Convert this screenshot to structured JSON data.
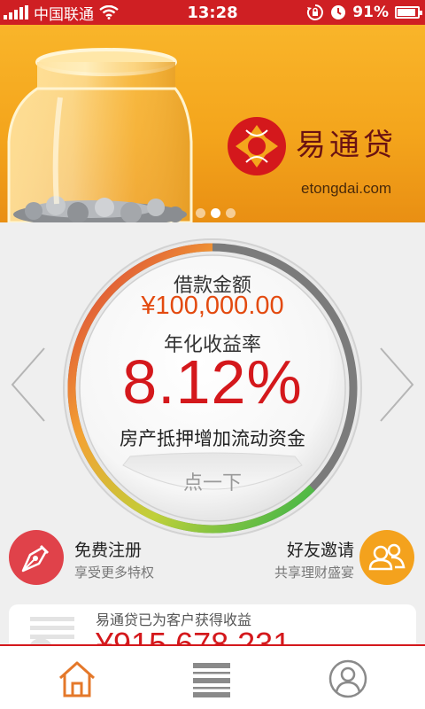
{
  "status_bar": {
    "carrier": "中国联通",
    "time": "13:28",
    "battery": "91%",
    "battery_level": 0.91,
    "icons": [
      "signal-icon",
      "wifi-icon",
      "rotation-lock-icon",
      "alarm-icon",
      "battery-icon"
    ]
  },
  "banner": {
    "brand_name": "易通贷",
    "brand_url": "etongdai.com",
    "slide_count": 3,
    "active_slide": 2
  },
  "gauge": {
    "loan_label": "借款金额",
    "loan_amount": "¥100,000.00",
    "rate_label": "年化收益率",
    "rate_value": "8.12%",
    "product_name": "房产抵押增加流动资金",
    "action_label": "点一下",
    "progress": 0.7
  },
  "actions": {
    "register": {
      "title": "免费注册",
      "subtitle": "享受更多特权",
      "icon": "pen-nib-icon"
    },
    "invite": {
      "title": "好友邀请",
      "subtitle": "共享理财盛宴",
      "icon": "friends-icon"
    }
  },
  "earnings": {
    "label": "易通贷已为客户获得收益",
    "value": "¥915,678,231"
  },
  "tabs": [
    {
      "name": "home",
      "icon": "home-icon",
      "active": true
    },
    {
      "name": "list",
      "icon": "list-icon",
      "active": false
    },
    {
      "name": "user",
      "icon": "user-icon",
      "active": false
    }
  ],
  "colors": {
    "brand_red": "#d4181c",
    "status_bar": "#cf1f23",
    "amount_orange": "#e34a0f",
    "register_red": "#e0424a",
    "invite_orange": "#f4a21d",
    "banner_gold": "#f4a51c"
  }
}
